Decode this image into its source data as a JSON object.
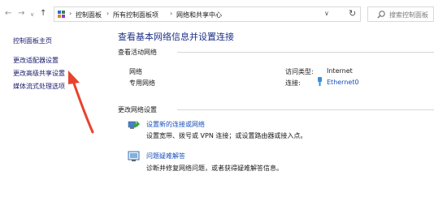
{
  "breadcrumb": [
    "控制面板",
    "所有控制面板项",
    "网络和共享中心"
  ],
  "search": {
    "placeholder": "搜索控制面板"
  },
  "sidebar": {
    "items": [
      {
        "label": "控制面板主页"
      },
      {
        "label": "更改适配器设置"
      },
      {
        "label": "更改高级共享设置"
      },
      {
        "label": "媒体流式处理选项"
      }
    ]
  },
  "main": {
    "title": "查看基本网络信息并设置连接",
    "active_networks_label": "查看活动网络",
    "network": {
      "name": "网络",
      "type": "专用网络",
      "access_type_label": "访问类型:",
      "access_type_value": "Internet",
      "connection_label": "连接:",
      "connection_value": "Ethernet0"
    },
    "change_settings_label": "更改网络设置",
    "tasks": [
      {
        "title": "设置新的连接或网络",
        "desc": "设置宽带、拨号或 VPN 连接；或设置路由器或接入点。",
        "icon": "network-setup-icon"
      },
      {
        "title": "问题疑难解答",
        "desc": "诊断并修复网络问题，或者获得疑难解答信息。",
        "icon": "troubleshoot-icon"
      }
    ]
  },
  "annotation": {
    "color": "#e8432f"
  }
}
